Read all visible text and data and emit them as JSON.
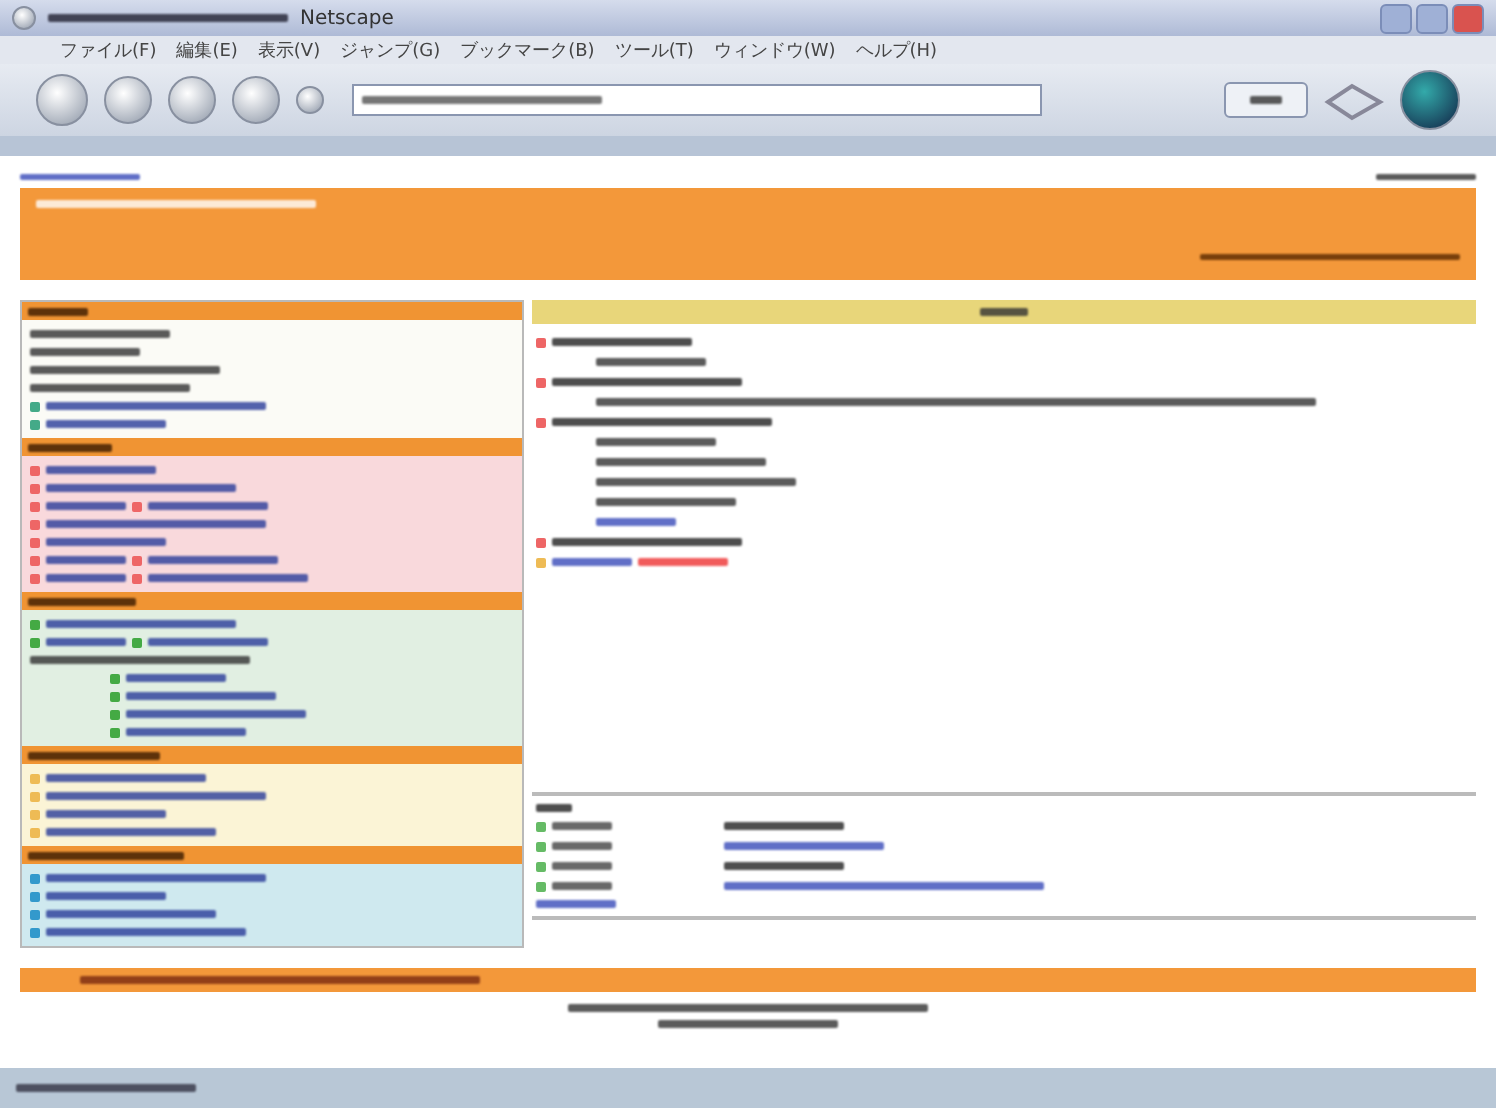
{
  "window": {
    "title": "Netscape"
  },
  "menu": [
    "ファイル(F)",
    "編集(E)",
    "表示(V)",
    "ジャンプ(G)",
    "ブックマーク(B)",
    "ツール(T)",
    "ウィンドウ(W)",
    "ヘルプ(H)"
  ],
  "sidebar": {
    "sections": [
      {
        "color": "#fbfbf6",
        "items": [
          {
            "kind": "text"
          },
          {
            "kind": "text"
          },
          {
            "kind": "text"
          },
          {
            "kind": "text"
          },
          {
            "kind": "link"
          },
          {
            "kind": "link"
          }
        ]
      },
      {
        "color": "#f9d9dc",
        "items": [
          {
            "kind": "link"
          },
          {
            "kind": "link"
          },
          {
            "kind": "pair"
          },
          {
            "kind": "link"
          },
          {
            "kind": "link"
          },
          {
            "kind": "pair"
          },
          {
            "kind": "pair"
          }
        ]
      },
      {
        "color": "#e1efe2",
        "items": [
          {
            "kind": "link"
          },
          {
            "kind": "pair"
          },
          {
            "kind": "text"
          },
          {
            "kind": "sublink"
          },
          {
            "kind": "sublink"
          },
          {
            "kind": "sublink"
          },
          {
            "kind": "sublink"
          }
        ]
      },
      {
        "color": "#fbf4d6",
        "items": [
          {
            "kind": "link"
          },
          {
            "kind": "link"
          },
          {
            "kind": "link"
          },
          {
            "kind": "link"
          }
        ]
      },
      {
        "color": "#cfe9ef",
        "items": [
          {
            "kind": "link"
          },
          {
            "kind": "link"
          },
          {
            "kind": "link"
          },
          {
            "kind": "link"
          }
        ]
      }
    ]
  },
  "notices": [
    {
      "kind": "heading"
    },
    {
      "kind": "line"
    },
    {
      "kind": "heading"
    },
    {
      "kind": "line"
    },
    {
      "kind": "heading"
    },
    {
      "kind": "line"
    },
    {
      "kind": "line"
    },
    {
      "kind": "line"
    },
    {
      "kind": "line"
    },
    {
      "kind": "link"
    },
    {
      "kind": "heading"
    },
    {
      "kind": "alert"
    }
  ],
  "news": [
    {
      "kind": "text"
    },
    {
      "kind": "link"
    },
    {
      "kind": "text"
    },
    {
      "kind": "link"
    }
  ]
}
